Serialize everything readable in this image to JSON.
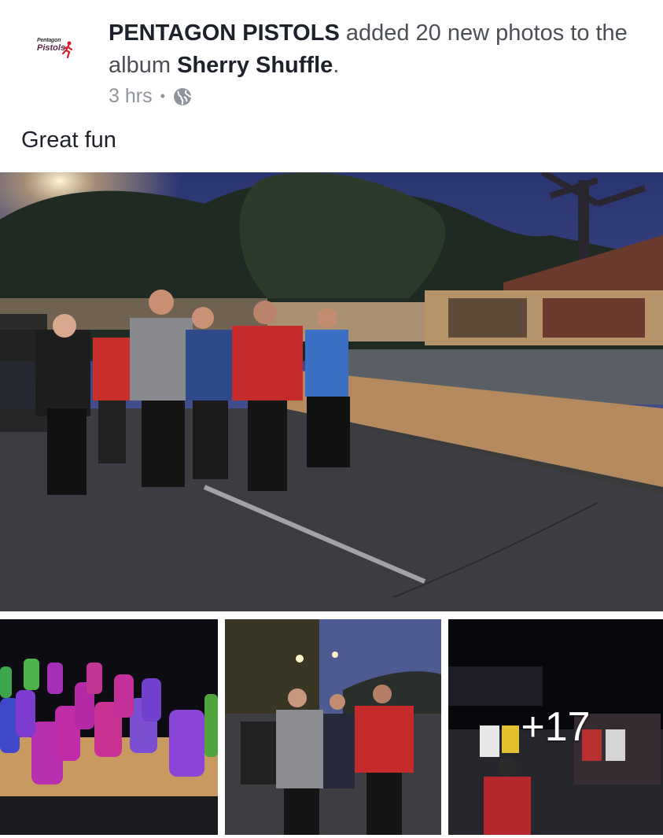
{
  "post": {
    "author": "PENTAGON PISTOLS",
    "action": "added 20 new photos to the album",
    "album": "Sherry Shuffle",
    "period": ".",
    "time": "3 hrs",
    "separator": "•",
    "audience_icon": "globe-icon",
    "caption": "Great fun",
    "avatar": {
      "line1": "Pentagon",
      "line2": "Pistols",
      "icon": "runner-logo"
    }
  },
  "photos": {
    "main": {
      "description_icon": "photo"
    },
    "more_count": "+17"
  },
  "colors": {
    "secondary_text": "#90949c",
    "primary_text": "#1d2129",
    "logo_red": "#d0202e"
  }
}
